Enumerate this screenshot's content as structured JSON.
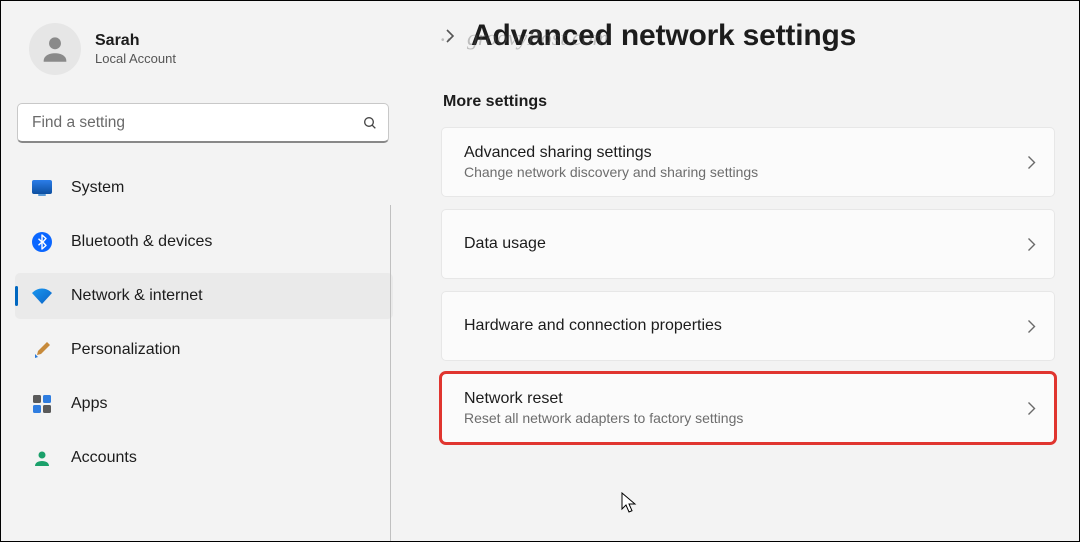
{
  "profile": {
    "name": "Sarah",
    "sub": "Local Account"
  },
  "search": {
    "placeholder": "Find a setting"
  },
  "nav": {
    "items": [
      {
        "label": "System"
      },
      {
        "label": "Bluetooth & devices"
      },
      {
        "label": "Network & internet"
      },
      {
        "label": "Personalization"
      },
      {
        "label": "Apps"
      },
      {
        "label": "Accounts"
      }
    ]
  },
  "main": {
    "title": "Advanced network settings",
    "section": "More settings",
    "cards": [
      {
        "title": "Advanced sharing settings",
        "sub": "Change network discovery and sharing settings"
      },
      {
        "title": "Data usage",
        "sub": ""
      },
      {
        "title": "Hardware and connection properties",
        "sub": ""
      },
      {
        "title": "Network reset",
        "sub": "Reset all network adapters to factory settings"
      }
    ]
  },
  "watermark": "groovyPost.com"
}
